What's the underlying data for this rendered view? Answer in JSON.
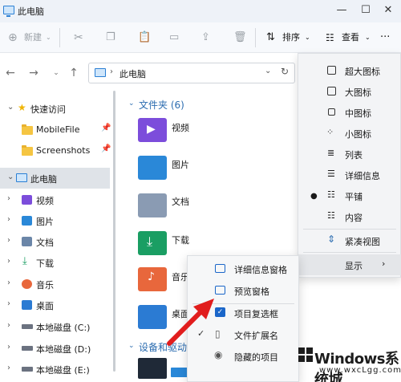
{
  "window": {
    "title": "此电脑",
    "controls": [
      "—",
      "☐",
      "✕"
    ]
  },
  "commandbar": {
    "new_label": "新建",
    "sort_label": "排序",
    "view_label": "查看",
    "more": "···"
  },
  "address": {
    "path": "此电脑"
  },
  "sidebar": {
    "items": [
      {
        "label": "快速访问"
      },
      {
        "label": "MobileFile"
      },
      {
        "label": "Screenshots"
      },
      {
        "label": "此电脑"
      },
      {
        "label": "视频"
      },
      {
        "label": "图片"
      },
      {
        "label": "文档"
      },
      {
        "label": "下载"
      },
      {
        "label": "音乐"
      },
      {
        "label": "桌面"
      },
      {
        "label": "本地磁盘 (C:)"
      },
      {
        "label": "本地磁盘 (D:)"
      },
      {
        "label": "本地磁盘 (E:)"
      }
    ]
  },
  "content": {
    "folders_heading": "文件夹",
    "folders_count": "(6)",
    "folders": [
      {
        "label": "视频"
      },
      {
        "label": "图片"
      },
      {
        "label": "文档"
      },
      {
        "label": "下载"
      },
      {
        "label": "音乐"
      },
      {
        "label": "桌面"
      }
    ],
    "devices_heading": "设备和驱动"
  },
  "view_menu": {
    "items": [
      {
        "label": "超大图标"
      },
      {
        "label": "大图标"
      },
      {
        "label": "中图标"
      },
      {
        "label": "小图标"
      },
      {
        "label": "列表"
      },
      {
        "label": "详细信息"
      },
      {
        "label": "平铺"
      },
      {
        "label": "内容"
      },
      {
        "label": "紧凑视图"
      },
      {
        "label": "显示"
      }
    ]
  },
  "show_submenu": {
    "items": [
      {
        "label": "详细信息窗格"
      },
      {
        "label": "预览窗格"
      },
      {
        "label": "项目复选框"
      },
      {
        "label": "文件扩展名"
      },
      {
        "label": "隐藏的项目"
      }
    ]
  },
  "watermark": {
    "title": "Windows系统城",
    "url": "www.wxcLgg.com"
  },
  "colors": {
    "accent": "#2b6cb0",
    "arrow": "#e11d1d",
    "folder": "#f5c542"
  }
}
